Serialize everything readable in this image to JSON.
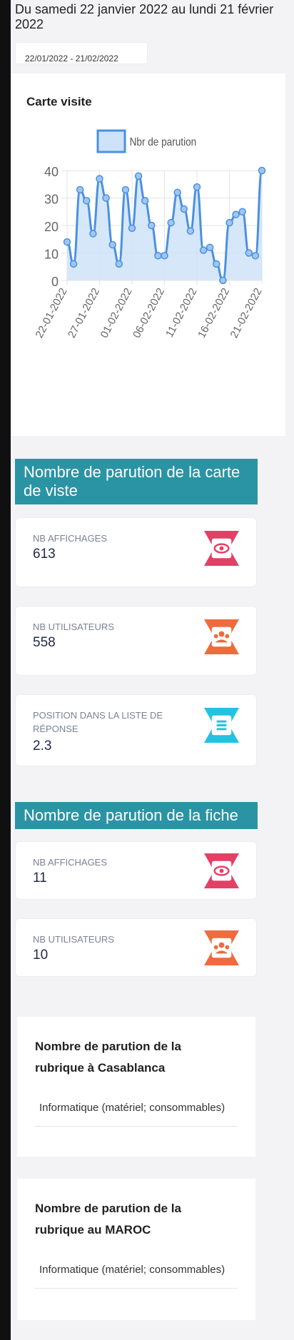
{
  "header": {
    "title": "Du samedi 22 janvier 2022 au lundi 21 février 2022"
  },
  "date_filter": {
    "value": "22/01/2022 - 21/02/2022"
  },
  "chart_card": {
    "title": "Carte visite"
  },
  "chart_data": {
    "type": "area",
    "legend": [
      "Nbr de parution"
    ],
    "legend_position": "top",
    "series": [
      {
        "name": "Nbr de parution",
        "values": [
          14,
          6,
          33,
          29,
          17,
          37,
          30,
          13,
          6,
          33,
          19,
          38,
          29,
          20,
          9,
          9,
          21,
          32,
          26,
          18,
          34,
          11,
          12,
          6,
          0,
          21,
          24,
          25,
          10,
          9,
          40
        ]
      }
    ],
    "x_tick_labels": [
      "22-01-2022",
      "27-01-2022",
      "01-02-2022",
      "06-02-2022",
      "11-02-2022",
      "16-02-2022",
      "21-02-2022"
    ],
    "y_tick_labels": [
      "0",
      "10",
      "20",
      "30",
      "40"
    ],
    "ylim": [
      0,
      40
    ],
    "grid": true,
    "colors": {
      "line": "#4a90e2",
      "fill": "#cfe3f8",
      "point_fill": "#9fc6f0"
    }
  },
  "section_carte": {
    "title": "Nombre de parution de la carte de viste",
    "stats": [
      {
        "label": "NB AFFICHAGES",
        "value": "613",
        "icon": "eye-icon",
        "color": "#e24166"
      },
      {
        "label": "NB UTILISATEURS",
        "value": "558",
        "icon": "users-icon",
        "color": "#ee6b3e"
      },
      {
        "label": "POSITION DANS LA LISTE DE RÉPONSE",
        "value": "2.3",
        "icon": "list-icon",
        "color": "#22c3e0"
      }
    ]
  },
  "section_fiche": {
    "title": "Nombre de parution de la fiche",
    "stats": [
      {
        "label": "NB AFFICHAGES",
        "value": "11",
        "icon": "eye-icon",
        "color": "#e24166"
      },
      {
        "label": "NB UTILISATEURS",
        "value": "10",
        "icon": "users-icon",
        "color": "#ee6b3e"
      }
    ]
  },
  "rubrique_casablanca": {
    "title": "Nombre de parution de la rubrique à Casablanca",
    "items": [
      "Informatique (matériel; consommables)"
    ]
  },
  "rubrique_maroc": {
    "title": "Nombre de parution de la rubrique au MAROC",
    "items": [
      "Informatique (matériel; consommables)"
    ]
  },
  "colors": {
    "banner": "#2a94a4",
    "value_text": "#232a4a",
    "label_text": "#7c8296"
  }
}
